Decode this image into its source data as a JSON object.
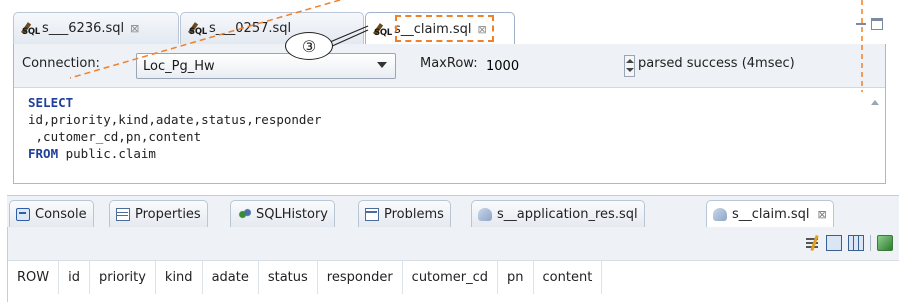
{
  "editor_tabs": [
    {
      "label": "s___6236.sql",
      "close": "⊠",
      "icon_label": "SQL"
    },
    {
      "label": "s___0257.sql",
      "close": "",
      "icon_label": "SQL"
    },
    {
      "label": "s__claim.sql",
      "close": "⊠",
      "icon_label": "SQL"
    }
  ],
  "toolbar": {
    "connection_label": "Connection:",
    "connection_value": "Loc_Pg_Hw",
    "maxrow_label": "MaxRow:",
    "maxrow_value": "1000",
    "status": "parsed success (4msec)"
  },
  "sql_lines": {
    "l1": "SELECT",
    "l2": "id,priority,kind,adate,status,responder",
    "l3": " ,cutomer_cd,pn,content",
    "l4_kw": "FROM",
    "l4_rest": " public.claim"
  },
  "annotation": {
    "marker": "③",
    "color": "#f0802a"
  },
  "bottom_tabs": [
    {
      "label": "Console",
      "icon": "console-icon"
    },
    {
      "label": "Properties",
      "icon": "properties-icon"
    },
    {
      "label": "SQLHistory",
      "icon": "sql-history-icon"
    },
    {
      "label": "Problems",
      "icon": "problems-icon"
    },
    {
      "label": "s__application_res.sql",
      "icon": "sql-file-icon"
    },
    {
      "label": "s__claim.sql",
      "icon": "sql-file-icon",
      "close": "⊠"
    }
  ],
  "result_columns": [
    "ROW",
    "id",
    "priority",
    "kind",
    "adate",
    "status",
    "responder",
    "cutomer_cd",
    "pn",
    "content"
  ],
  "colors": {
    "keyword": "#1f3f9a",
    "border": "#a9b9cd",
    "toolbar_bg": "#eef1f5"
  }
}
